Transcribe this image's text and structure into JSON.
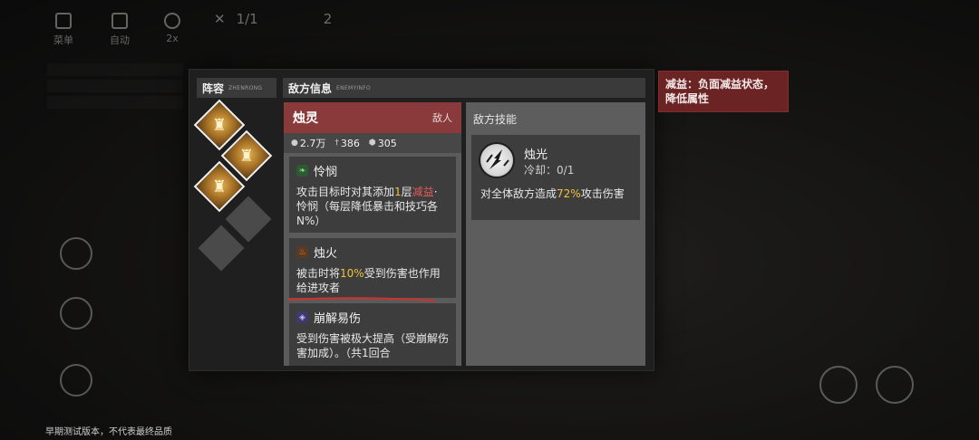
{
  "hud": {
    "menu_label": "菜单",
    "auto_label": "自动",
    "speed_label": "2x",
    "round_text": "1/1",
    "wave_text": "2"
  },
  "lineup": {
    "title": "阵容",
    "subtitle": "ZHENRONG"
  },
  "enemy_info": {
    "title": "敌方信息",
    "subtitle": "ENEMYINFO",
    "enemy": {
      "name": "烛灵",
      "tag": "敌人",
      "stats": {
        "hp": "2.7万",
        "atk": "386",
        "def": "305"
      }
    },
    "traits": [
      {
        "name": "怜悯",
        "desc_parts": [
          "攻击目标时对其添加",
          "1",
          "层",
          "减益",
          "· 怜悯（每层降低暴击和技巧各N%）"
        ]
      },
      {
        "name": "烛火",
        "desc_parts": [
          "被击时将",
          "10%",
          "受到伤害也作用给进攻者"
        ]
      },
      {
        "name": "崩解易伤",
        "desc": "受到伤害被极大提高（受崩解伤害加成）。（共1回合"
      }
    ]
  },
  "enemy_skills": {
    "title": "敌方技能",
    "skill": {
      "name": "烛光",
      "cooldown_label": "冷却：",
      "cooldown_value": "0/1",
      "desc_parts": [
        "对全体敌方造成",
        "72%",
        "攻击伤害"
      ]
    }
  },
  "tooltip": {
    "text": "减益：负面减益状态，降低属性"
  },
  "footer": {
    "note": "早期测试版本，不代表最终品质"
  },
  "colors": {
    "enemy_header": "#8a3a3a",
    "highlight_yellow": "#f0c23a",
    "highlight_red": "#e35b5b",
    "tooltip_bg": "#6b2323"
  }
}
